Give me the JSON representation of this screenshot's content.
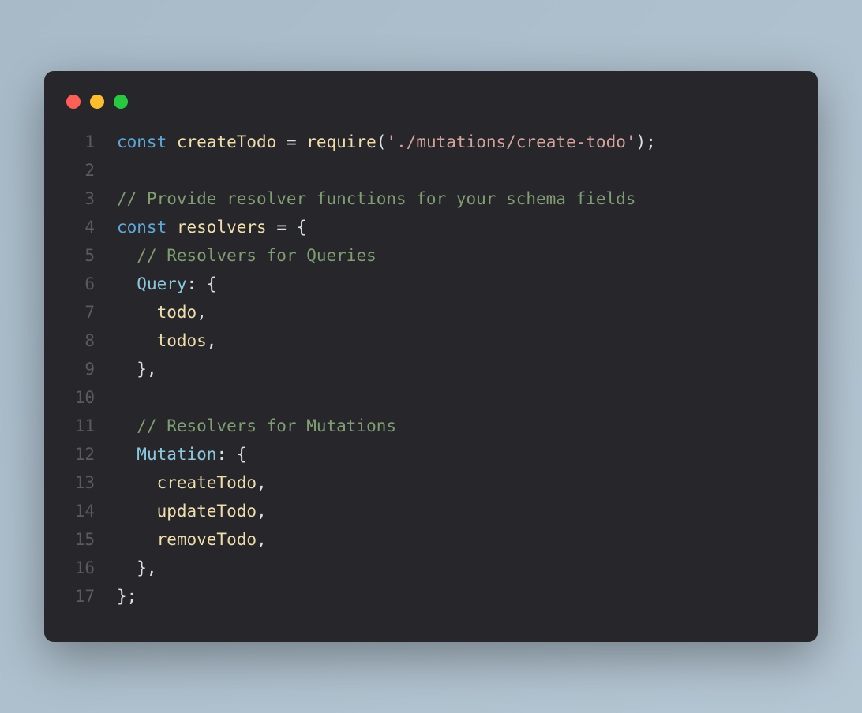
{
  "window": {
    "controls": {
      "close": "close",
      "minimize": "minimize",
      "maximize": "maximize"
    }
  },
  "code": {
    "lines": [
      {
        "num": "1",
        "tokens": [
          {
            "cls": "tk-keyword",
            "text": "const"
          },
          {
            "cls": "tk-plain",
            "text": " "
          },
          {
            "cls": "tk-identifier",
            "text": "createTodo"
          },
          {
            "cls": "tk-plain",
            "text": " = "
          },
          {
            "cls": "tk-func",
            "text": "require"
          },
          {
            "cls": "tk-plain",
            "text": "("
          },
          {
            "cls": "tk-string",
            "text": "'./mutations/create-todo'"
          },
          {
            "cls": "tk-plain",
            "text": ");"
          }
        ]
      },
      {
        "num": "2",
        "tokens": []
      },
      {
        "num": "3",
        "tokens": [
          {
            "cls": "tk-comment",
            "text": "// Provide resolver functions for your schema fields"
          }
        ]
      },
      {
        "num": "4",
        "tokens": [
          {
            "cls": "tk-keyword",
            "text": "const"
          },
          {
            "cls": "tk-plain",
            "text": " "
          },
          {
            "cls": "tk-identifier",
            "text": "resolvers"
          },
          {
            "cls": "tk-plain",
            "text": " = {"
          }
        ]
      },
      {
        "num": "5",
        "tokens": [
          {
            "cls": "tk-plain",
            "text": "  "
          },
          {
            "cls": "tk-comment",
            "text": "// Resolvers for Queries"
          }
        ]
      },
      {
        "num": "6",
        "tokens": [
          {
            "cls": "tk-plain",
            "text": "  "
          },
          {
            "cls": "tk-prop",
            "text": "Query"
          },
          {
            "cls": "tk-plain",
            "text": ": {"
          }
        ]
      },
      {
        "num": "7",
        "tokens": [
          {
            "cls": "tk-plain",
            "text": "    "
          },
          {
            "cls": "tk-identifier",
            "text": "todo"
          },
          {
            "cls": "tk-plain",
            "text": ","
          }
        ]
      },
      {
        "num": "8",
        "tokens": [
          {
            "cls": "tk-plain",
            "text": "    "
          },
          {
            "cls": "tk-identifier",
            "text": "todos"
          },
          {
            "cls": "tk-plain",
            "text": ","
          }
        ]
      },
      {
        "num": "9",
        "tokens": [
          {
            "cls": "tk-plain",
            "text": "  },"
          }
        ]
      },
      {
        "num": "10",
        "tokens": []
      },
      {
        "num": "11",
        "tokens": [
          {
            "cls": "tk-plain",
            "text": "  "
          },
          {
            "cls": "tk-comment",
            "text": "// Resolvers for Mutations"
          }
        ]
      },
      {
        "num": "12",
        "tokens": [
          {
            "cls": "tk-plain",
            "text": "  "
          },
          {
            "cls": "tk-prop",
            "text": "Mutation"
          },
          {
            "cls": "tk-plain",
            "text": ": {"
          }
        ]
      },
      {
        "num": "13",
        "tokens": [
          {
            "cls": "tk-plain",
            "text": "    "
          },
          {
            "cls": "tk-identifier",
            "text": "createTodo"
          },
          {
            "cls": "tk-plain",
            "text": ","
          }
        ]
      },
      {
        "num": "14",
        "tokens": [
          {
            "cls": "tk-plain",
            "text": "    "
          },
          {
            "cls": "tk-identifier",
            "text": "updateTodo"
          },
          {
            "cls": "tk-plain",
            "text": ","
          }
        ]
      },
      {
        "num": "15",
        "tokens": [
          {
            "cls": "tk-plain",
            "text": "    "
          },
          {
            "cls": "tk-identifier",
            "text": "removeTodo"
          },
          {
            "cls": "tk-plain",
            "text": ","
          }
        ]
      },
      {
        "num": "16",
        "tokens": [
          {
            "cls": "tk-plain",
            "text": "  },"
          }
        ]
      },
      {
        "num": "17",
        "tokens": [
          {
            "cls": "tk-plain",
            "text": "};"
          }
        ]
      }
    ]
  }
}
